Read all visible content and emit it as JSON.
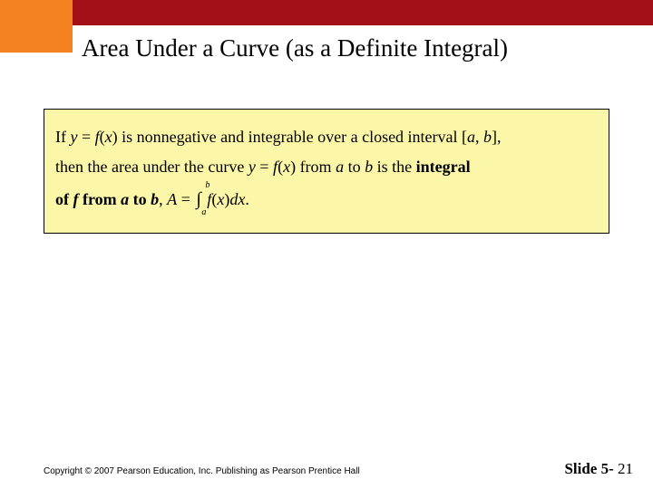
{
  "title": "Area Under a Curve (as a Definite Integral)",
  "box": {
    "p1_a": "If ",
    "p1_b": " is nonnegative and integrable over a closed interval ",
    "p1_c": ",",
    "p2_a": "then the area under the curve ",
    "p2_b": " from ",
    "p2_c": " to ",
    "p2_d": " is the ",
    "p2_e": "integral",
    "p3_a": "of ",
    "p3_b": " from ",
    "p3_c": " to ",
    "p3_d": ", ",
    "eq_y": "y",
    "eq_eq": " = ",
    "eq_f": "f",
    "eq_lp": "(",
    "eq_x": "x",
    "eq_rp": ")",
    "int_lb": "[",
    "int_a": "a",
    "int_comma": ", ",
    "int_b": "b",
    "int_rb": "]",
    "var_f": "f",
    "var_a": "a",
    "var_b": "b",
    "Afrag_A": "A",
    "Afrag_eq": " = ",
    "int_sym": "∫",
    "int_low": "a",
    "int_up": "b",
    "dx": "dx",
    "period": "."
  },
  "footer": "Copyright © 2007 Pearson Education, Inc. Publishing as Pearson Prentice Hall",
  "slide": {
    "label": "Slide 5- ",
    "num": "21"
  }
}
